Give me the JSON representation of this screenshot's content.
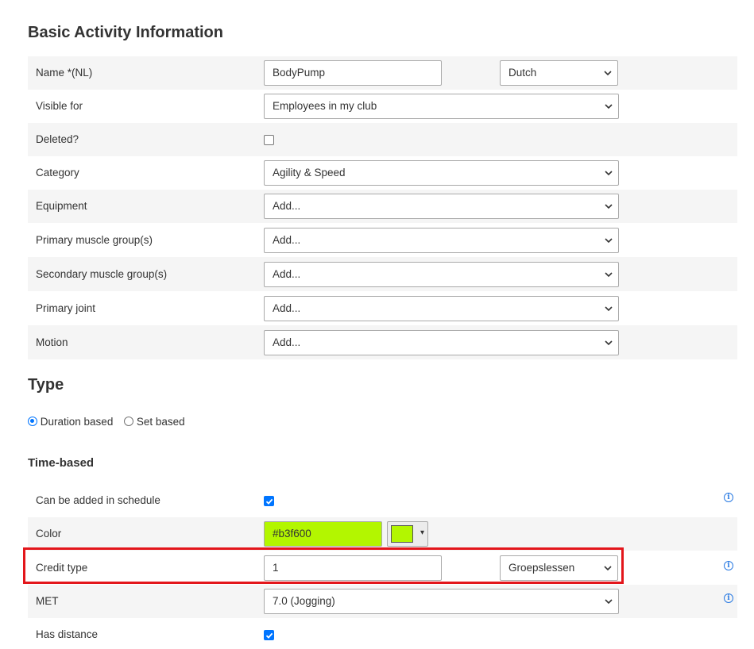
{
  "sections": {
    "basic_title": "Basic Activity Information",
    "type_title": "Type",
    "time_based_title": "Time-based"
  },
  "basic": {
    "name": {
      "label": "Name *(NL)",
      "value": "BodyPump",
      "language": "Dutch"
    },
    "visible_for": {
      "label": "Visible for",
      "value": "Employees in my club"
    },
    "deleted": {
      "label": "Deleted?",
      "checked": false
    },
    "category": {
      "label": "Category",
      "value": "Agility & Speed"
    },
    "equipment": {
      "label": "Equipment",
      "value": "Add..."
    },
    "primary_muscle": {
      "label": "Primary muscle group(s)",
      "value": "Add..."
    },
    "secondary_muscle": {
      "label": "Secondary muscle group(s)",
      "value": "Add..."
    },
    "primary_joint": {
      "label": "Primary joint",
      "value": "Add..."
    },
    "motion": {
      "label": "Motion",
      "value": "Add..."
    }
  },
  "type": {
    "options": [
      {
        "label": "Duration based",
        "selected": true
      },
      {
        "label": "Set based",
        "selected": false
      }
    ]
  },
  "time_based": {
    "schedule": {
      "label": "Can be added in schedule",
      "checked": true
    },
    "color": {
      "label": "Color",
      "value": "#b3f600",
      "hex": "#b3f600"
    },
    "credit": {
      "label": "Credit type",
      "value": "1",
      "type": "Groepslessen"
    },
    "met": {
      "label": "MET",
      "value": "7.0 (Jogging)"
    },
    "distance": {
      "label": "Has distance",
      "checked": true
    }
  },
  "icons": {
    "info": "i",
    "dropdown": "▾"
  },
  "colors": {
    "highlight": "#e3161b",
    "accent": "#0075ff",
    "info": "#2a7ae2"
  }
}
